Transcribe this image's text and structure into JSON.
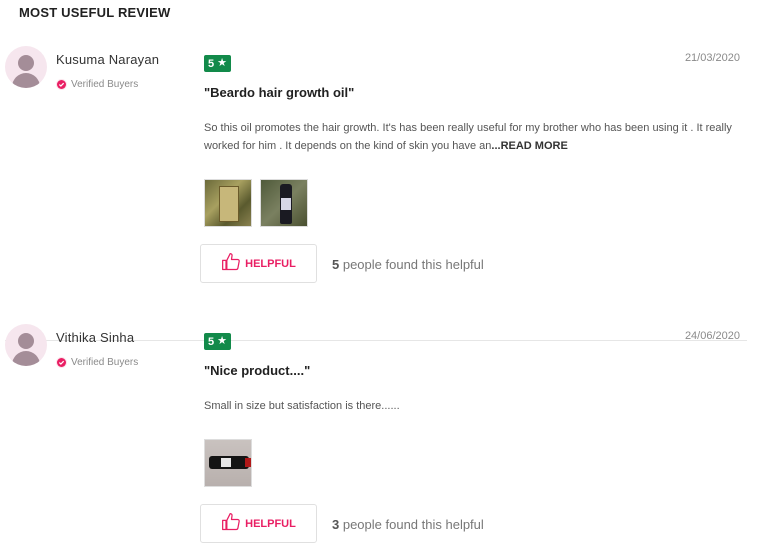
{
  "section_title": "MOST USEFUL REVIEW",
  "colors": {
    "rating_green": "#128a4a",
    "accent_pink": "#e91e63",
    "avatar_bg": "#f6e6ee"
  },
  "reviews": [
    {
      "user_name": "Kusuma Narayan",
      "verified_label": "Verified Buyers",
      "rating": "5",
      "rating_icon": "star-icon",
      "date": "21/03/2020",
      "title": "\"Beardo hair growth oil\"",
      "text": "So this oil promotes the hair growth. It's has been really useful for my brother who has been using it . It really worked for him . It depends on the kind of skin you have an",
      "read_more": "...READ MORE",
      "helpful_label": "HELPFUL",
      "helpful_count": "5",
      "helpful_suffix": " people found this helpful"
    },
    {
      "user_name": "Vithika Sinha",
      "verified_label": "Verified Buyers",
      "rating": "5",
      "rating_icon": "star-icon",
      "date": "24/06/2020",
      "title": "\"Nice product....\"",
      "text": "Small in size but satisfaction is there......",
      "helpful_label": "HELPFUL",
      "helpful_count": "3",
      "helpful_suffix": " people found this helpful"
    }
  ]
}
